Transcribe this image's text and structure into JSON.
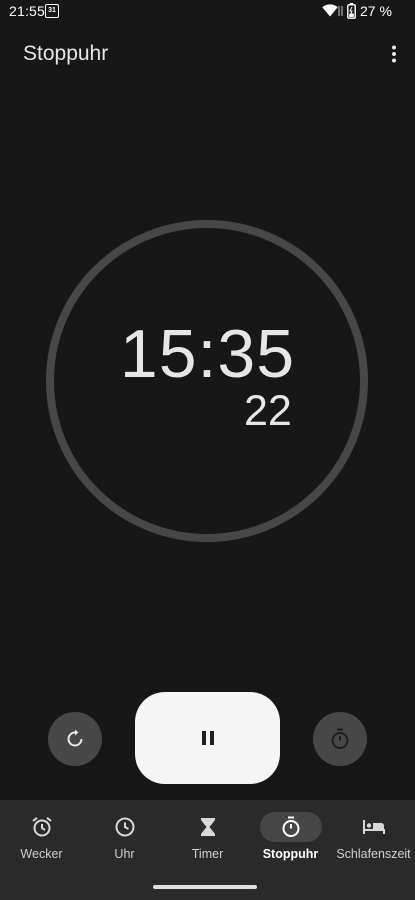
{
  "status_bar": {
    "time": "21:55",
    "calendar_day": "31",
    "battery": "27 %"
  },
  "app_bar": {
    "title": "Stoppuhr"
  },
  "stopwatch": {
    "main_time": "15:35",
    "hundredths": "22",
    "state": "running"
  },
  "controls": {
    "reset_icon": "reset-icon",
    "pause_icon": "pause-icon",
    "lap_icon": "stopwatch-lap-icon"
  },
  "nav": {
    "items": [
      {
        "label": "Wecker",
        "icon": "alarm-icon"
      },
      {
        "label": "Uhr",
        "icon": "clock-icon"
      },
      {
        "label": "Timer",
        "icon": "hourglass-icon"
      },
      {
        "label": "Stoppuhr",
        "icon": "stopwatch-icon"
      },
      {
        "label": "Schlafenszeit",
        "icon": "bed-icon"
      }
    ],
    "active": "Stoppuhr"
  },
  "colors": {
    "background": "#171717",
    "ring": "#474747",
    "nav_background": "#2a2a2a",
    "primary_button": "#f5f5f5"
  }
}
